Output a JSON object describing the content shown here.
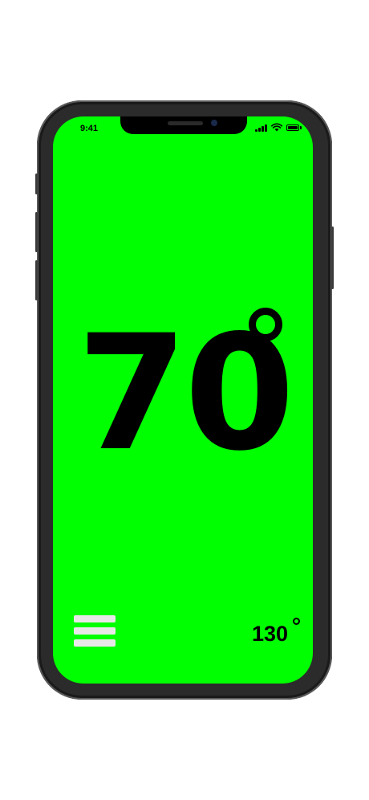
{
  "status_bar": {
    "time": "9:41",
    "signal_icon": "cellular-signal-icon",
    "wifi_icon": "wifi-icon",
    "battery_icon": "battery-icon"
  },
  "display": {
    "current_temperature": "70",
    "degree_symbol_icon": "degree-icon",
    "background_color": "#00ff00"
  },
  "footer": {
    "menu_icon": "hamburger-menu-icon",
    "target_temperature": "130"
  }
}
